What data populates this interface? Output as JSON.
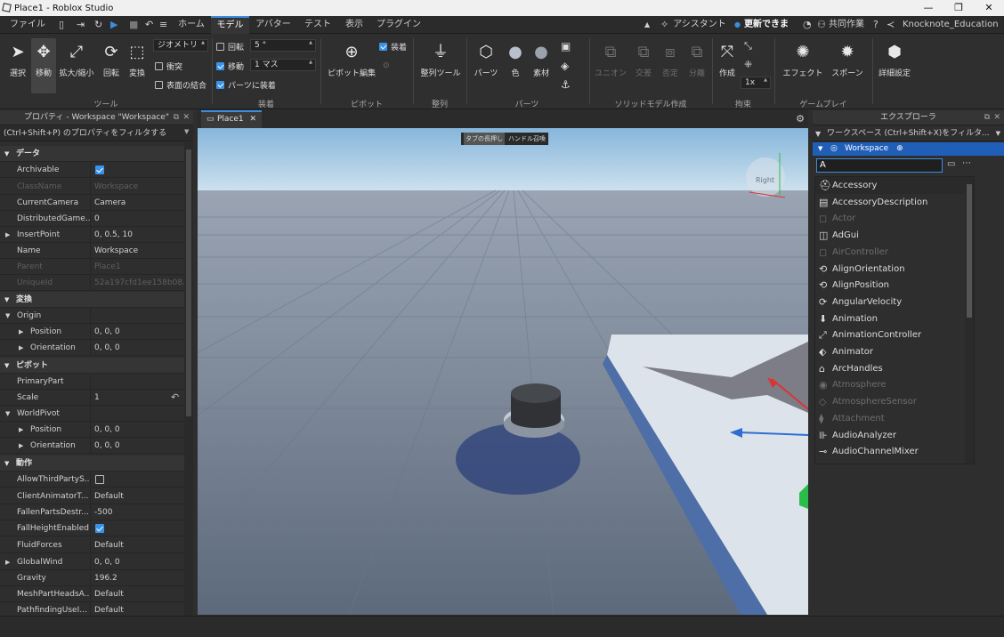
{
  "titlebar": {
    "title": "Place1 - Roblox Studio"
  },
  "menu": {
    "file": "ファイル",
    "home": "ホーム",
    "model": "モデル",
    "avatar": "アバター",
    "test": "テスト",
    "view": "表示",
    "plugins": "プラグイン",
    "assistant": "アシスタント",
    "update": "更新できます",
    "collab": "共同作業",
    "username": "Knocknote_Education"
  },
  "ribbon": {
    "select": "選択",
    "move": "移動",
    "scale": "拡大/縮小",
    "rotate": "回転",
    "transform": "変換",
    "geometry": "ジオメトリ",
    "collisions": "衝突",
    "join_surfaces": "表面の結合",
    "rotate_opt": "回転",
    "rotate_value": "5 °",
    "move_opt": "移動",
    "move_value": "1 マス",
    "equip_parts": "パーツに装着",
    "pivot_edit": "ピボット編集",
    "equip": "装着",
    "align_tool": "整列ツール",
    "part": "パーツ",
    "color": "色",
    "material": "素材",
    "union": "ユニオン",
    "intersect": "交差",
    "negate": "否定",
    "separate": "分離",
    "create": "作成",
    "zoom": "1x",
    "effects": "エフェクト",
    "spawn": "スポーン",
    "advanced": "詳細設定",
    "groups": {
      "tools": "ツール",
      "snap": "装着",
      "pivot": "ピボット",
      "align": "整列",
      "parts": "パーツ",
      "solid": "ソリッドモデル作成",
      "constraints": "拘束",
      "gameplay": "ゲームプレイ"
    }
  },
  "properties": {
    "header": "プロパティ - Workspace \"Workspace\"",
    "filter": "(Ctrl+Shift+P) のプロパティをフィルタする",
    "cat_data": "データ",
    "archivable": "Archivable",
    "classname": "ClassName",
    "classname_v": "Workspace",
    "currentcamera": "CurrentCamera",
    "currentcamera_v": "Camera",
    "distributed": "DistributedGame...",
    "distributed_v": "0",
    "insertpoint": "InsertPoint",
    "insertpoint_v": "0, 0.5, 10",
    "name": "Name",
    "name_v": "Workspace",
    "parent": "Parent",
    "parent_v": "Place1",
    "uniqueid": "UniqueId",
    "uniqueid_v": "52a197cfd1ee158b08...",
    "cat_transform": "変換",
    "origin": "Origin",
    "position": "Position",
    "position_v": "0, 0, 0",
    "orientation": "Orientation",
    "orientation_v": "0, 0, 0",
    "cat_pivot": "ピボット",
    "primarypart": "PrimaryPart",
    "scale": "Scale",
    "scale_v": "1",
    "worldpivot": "WorldPivot",
    "wp_position": "Position",
    "wp_position_v": "0, 0, 0",
    "wp_orientation": "Orientation",
    "wp_orientation_v": "0, 0, 0",
    "cat_behavior": "動作",
    "allowthird": "AllowThirdPartyS...",
    "clientanim": "ClientAnimatorT...",
    "clientanim_v": "Default",
    "fallenparts": "FallenPartsDestr...",
    "fallenparts_v": "-500",
    "fallheight": "FallHeightEnabled",
    "fluidforces": "FluidForces",
    "fluidforces_v": "Default",
    "globalwind": "GlobalWind",
    "globalwind_v": "0, 0, 0",
    "gravity": "Gravity",
    "gravity_v": "196.2",
    "meshpartheads": "MeshPartHeadsA...",
    "meshpartheads_v": "Default",
    "pathfinding": "PathfindingUseI...",
    "pathfinding_v": "Default"
  },
  "document": {
    "tab": "Place1",
    "hint_key": "タブの長押し",
    "hint_action": "ハンドル召喚",
    "viewcube": "Right"
  },
  "explorer": {
    "header": "エクスプローラ",
    "filter": "ワークスペース (Ctrl+Shift+X)をフィルタ...",
    "workspace": "Workspace",
    "search_value": "A",
    "items": [
      "Accessory",
      "AccessoryDescription",
      "Actor",
      "AdGui",
      "AirController",
      "AlignOrientation",
      "AlignPosition",
      "AngularVelocity",
      "Animation",
      "AnimationController",
      "Animator",
      "ArcHandles",
      "Atmosphere",
      "AtmosphereSensor",
      "Attachment",
      "AudioAnalyzer",
      "AudioChannelMixer"
    ]
  }
}
